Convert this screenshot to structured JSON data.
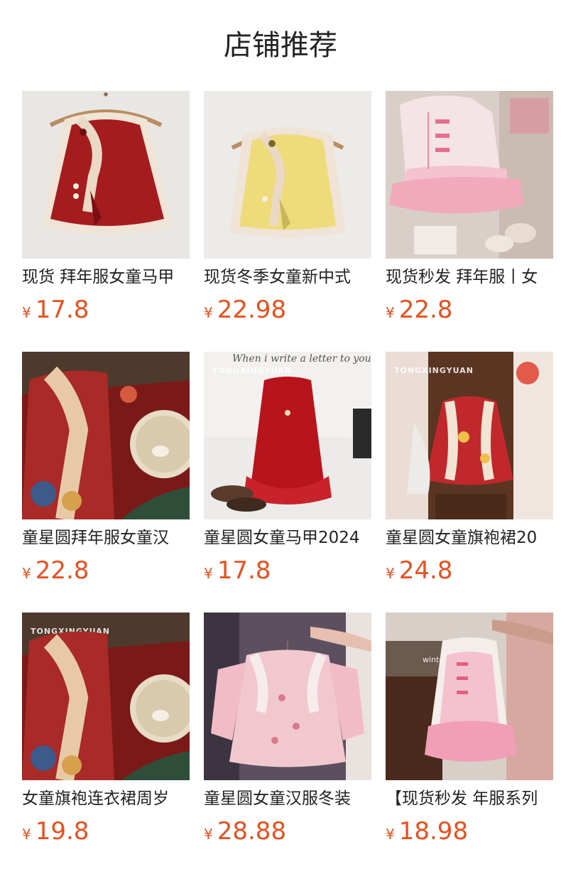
{
  "header": {
    "title": "店铺推荐"
  },
  "currency_symbol": "¥",
  "products": [
    {
      "title": "现货 拜年服女童马甲",
      "price": "17.8",
      "image": "red-fur-trim-vest"
    },
    {
      "title": "现货冬季女童新中式",
      "price": "22.98",
      "image": "yellow-fur-trim-vest"
    },
    {
      "title": "现货秒发 拜年服丨女",
      "price": "22.8",
      "image": "pink-fur-cape"
    },
    {
      "title": "童星圆拜年服女童汉",
      "price": "22.8",
      "image": "floral-red-jacket-with-fan"
    },
    {
      "title": "童星圆女童马甲2024",
      "price": "17.8",
      "image": "red-sparkle-vest",
      "watermark": "TONGXINGYUAN",
      "text_sample": "When i write a letter to you"
    },
    {
      "title": "童星圆女童旗袍裙20",
      "price": "24.8",
      "image": "floral-qipao-dress",
      "watermark": "TONGXINGYUAN"
    },
    {
      "title": "女童旗袍连衣裙周岁",
      "price": "19.8",
      "image": "floral-red-jacket-closeup",
      "watermark": "TONGXINGYUAN"
    },
    {
      "title": "童星圆女童汉服冬装",
      "price": "28.88",
      "image": "pink-floral-dress"
    },
    {
      "title": "【现货秒发 年服系列",
      "price": "18.98",
      "image": "pink-fur-vest-set",
      "text_sample": "winter"
    }
  ]
}
